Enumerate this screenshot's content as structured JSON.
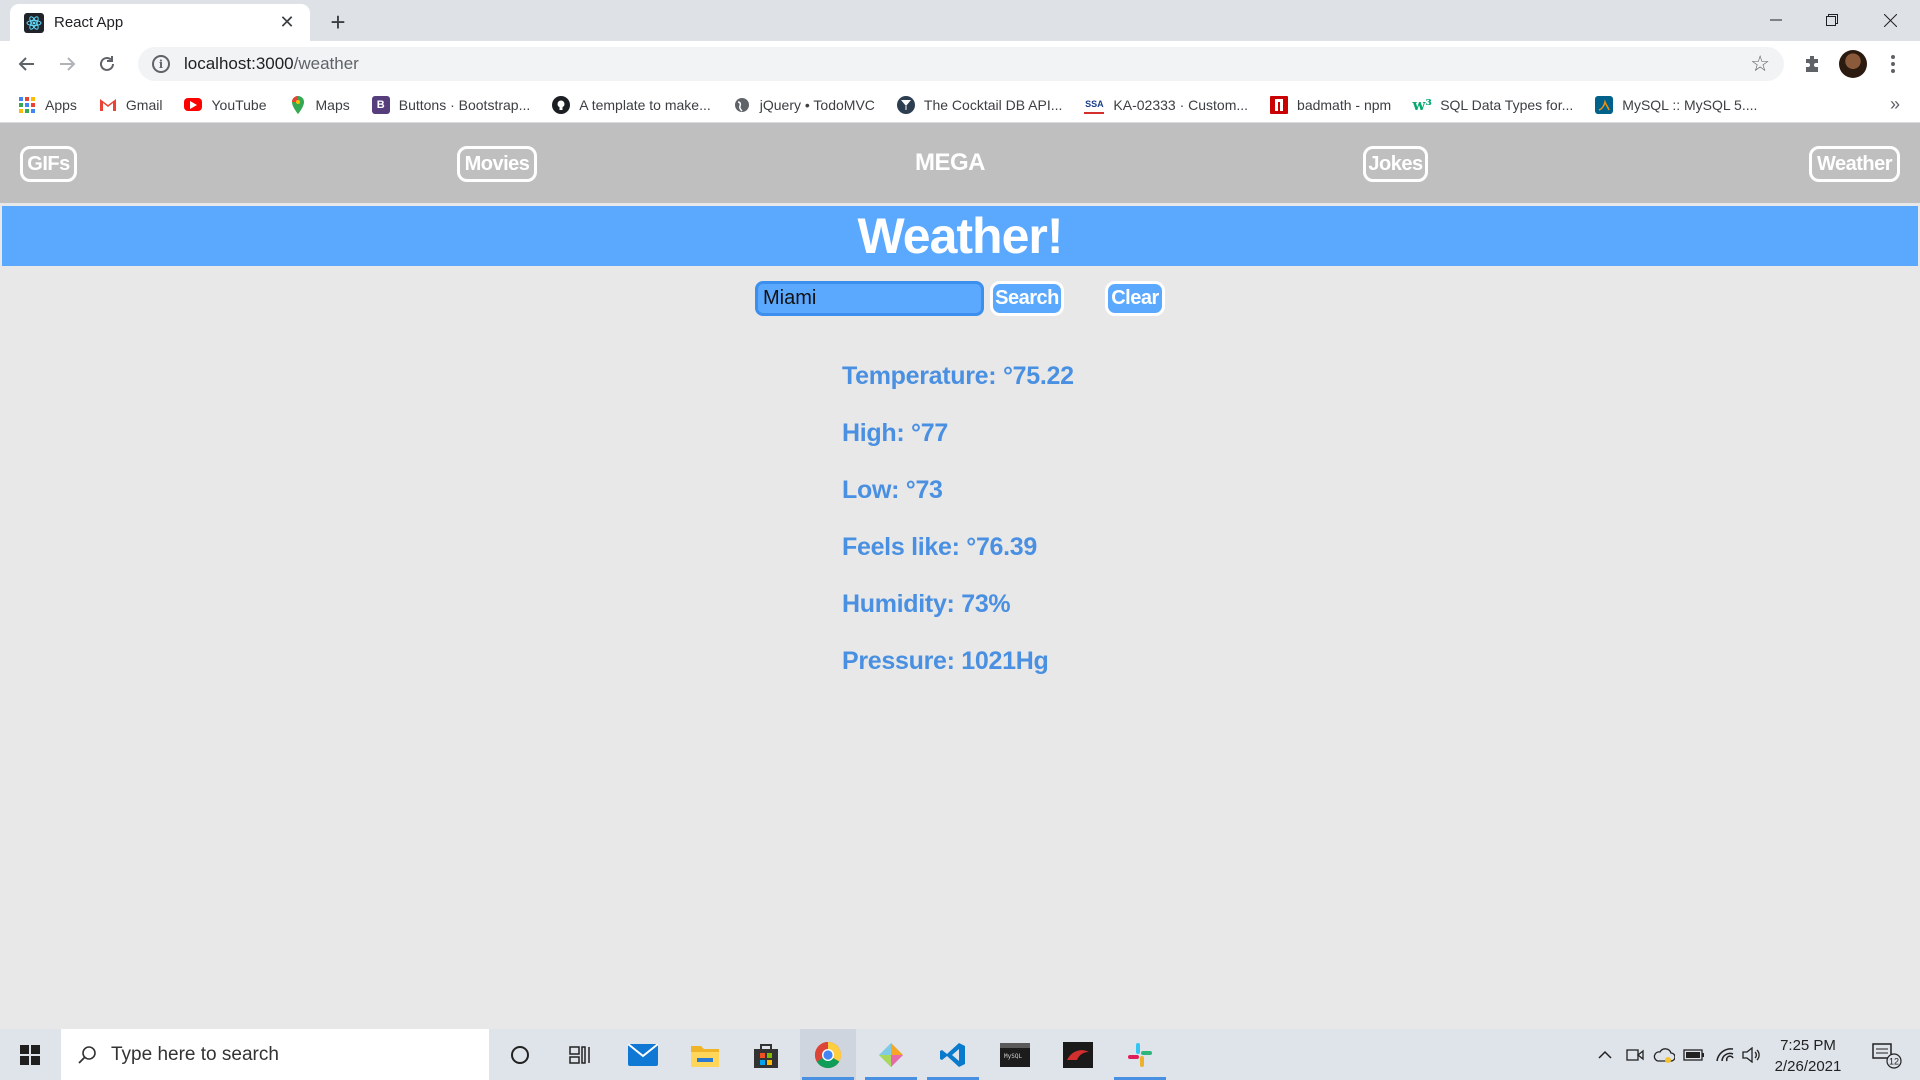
{
  "browser": {
    "tab_title": "React App",
    "tab_close": "✕",
    "new_tab": "+",
    "url_host": "localhost:3000",
    "url_path": "/weather",
    "bookmarks": [
      {
        "label": "Apps",
        "icon": "apps-grid-icon"
      },
      {
        "label": "Gmail",
        "icon": "gmail-icon"
      },
      {
        "label": "YouTube",
        "icon": "youtube-icon"
      },
      {
        "label": "Maps",
        "icon": "maps-icon"
      },
      {
        "label": "Buttons · Bootstrap...",
        "icon": "bootstrap-icon"
      },
      {
        "label": "A template to make...",
        "icon": "github-icon"
      },
      {
        "label": "jQuery • TodoMVC",
        "icon": "globe-icon"
      },
      {
        "label": "The Cocktail DB API...",
        "icon": "cocktail-icon"
      },
      {
        "label": "KA-02333 · Custom...",
        "icon": "ssa-icon"
      },
      {
        "label": "badmath - npm",
        "icon": "npm-icon"
      },
      {
        "label": "SQL Data Types for...",
        "icon": "w3schools-icon"
      },
      {
        "label": "MySQL :: MySQL 5....",
        "icon": "mysql-icon"
      }
    ],
    "bookmarks_more": "»"
  },
  "app": {
    "nav": {
      "gifs": "GIFs",
      "movies": "Movies",
      "brand": "MEGA",
      "jokes": "Jokes",
      "weather": "Weather"
    },
    "title": "Weather!",
    "search": {
      "value": "Miami",
      "search_label": "Search",
      "clear_label": "Clear"
    },
    "results": [
      "Temperature: °75.22",
      "High: °77",
      "Low: °73",
      "Feels like: °76.39",
      "Humidity: 73%",
      "Pressure: 1021Hg"
    ]
  },
  "taskbar": {
    "search_placeholder": "Type here to search",
    "time": "7:25 PM",
    "date": "2/26/2021",
    "notifications_count": "12"
  },
  "colors": {
    "nav_bg": "#bfbfbf",
    "hero_bg": "#5aa9ff",
    "result_text": "#4a90e2",
    "page_bg": "#e8e8e8"
  }
}
